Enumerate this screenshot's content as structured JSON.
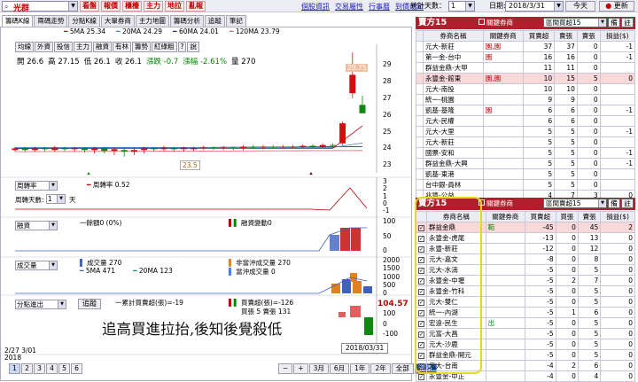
{
  "topbar": {
    "stock": "光群",
    "menu": [
      "看盤",
      "報價",
      "櫃檯",
      "主力",
      "地拉",
      "亂報"
    ],
    "links": [
      "個股資訊",
      "交易屬性",
      "行事曆",
      "到價通知"
    ],
    "stat_label": "統計天數：",
    "stat_days": "1",
    "date_label": "日期:",
    "date": "2018/3/31",
    "today_btn": "今天",
    "refresh_btn": "更新"
  },
  "left_tabs": [
    "籌碼K線",
    "兩碼走勢",
    "分點K線",
    "大單券商",
    "主力地圖",
    "籌碼分析",
    "追蹤",
    "筆記"
  ],
  "ma": [
    {
      "label": "5MA 25.34",
      "color": "#c00000"
    },
    {
      "label": "20MA 24.29",
      "color": "#4080c0"
    },
    {
      "label": "60MA 24.01",
      "color": "#203080"
    },
    {
      "label": "120MA 23.79",
      "color": "#e06060"
    }
  ],
  "chart_buttons": [
    "均線",
    "外資",
    "投信",
    "主力",
    "融資",
    "有林",
    "籌勢",
    "紅綠粗",
    "?",
    "說"
  ],
  "ohlc": {
    "open": "開 26.6",
    "high": "高 27.15",
    "low": "低 26.1",
    "close": "收 26.1",
    "change": "漲跌 -0.7",
    "pct": "漲幅 -2.61%",
    "vol": "量 270"
  },
  "price_axis": [
    "29",
    "28",
    "27",
    "26",
    "25",
    "24",
    "23"
  ],
  "high_marker": "29.75",
  "low_marker": "23.5",
  "candles": [
    {
      "o": 23.9,
      "c": 24.0,
      "h": 24.1,
      "l": 23.8
    },
    {
      "o": 24.0,
      "c": 23.9,
      "h": 24.1,
      "l": 23.8
    },
    {
      "o": 23.9,
      "c": 24.0,
      "h": 24.1,
      "l": 23.8
    },
    {
      "o": 24.0,
      "c": 23.95,
      "h": 24.1,
      "l": 23.8
    },
    {
      "o": 23.9,
      "c": 24.05,
      "h": 24.15,
      "l": 23.8
    },
    {
      "o": 24.0,
      "c": 23.95,
      "h": 24.1,
      "l": 23.85
    },
    {
      "o": 23.95,
      "c": 24.0,
      "h": 24.1,
      "l": 23.8
    },
    {
      "o": 24.0,
      "c": 23.9,
      "h": 24.05,
      "l": 23.75
    },
    {
      "o": 23.9,
      "c": 24.0,
      "h": 24.1,
      "l": 23.7
    },
    {
      "o": 24.0,
      "c": 23.85,
      "h": 24.1,
      "l": 23.7
    },
    {
      "o": 23.85,
      "c": 23.95,
      "h": 24.05,
      "l": 23.6
    },
    {
      "o": 23.9,
      "c": 23.8,
      "h": 24.0,
      "l": 23.5
    },
    {
      "o": 23.8,
      "c": 23.9,
      "h": 24.0,
      "l": 23.6
    },
    {
      "o": 23.9,
      "c": 24.0,
      "h": 24.1,
      "l": 23.7
    },
    {
      "o": 24.0,
      "c": 23.95,
      "h": 24.1,
      "l": 23.8
    },
    {
      "o": 23.95,
      "c": 24.05,
      "h": 24.15,
      "l": 23.85
    },
    {
      "o": 24.0,
      "c": 23.95,
      "h": 24.1,
      "l": 23.8
    },
    {
      "o": 23.95,
      "c": 24.05,
      "h": 24.1,
      "l": 23.8
    },
    {
      "o": 24.0,
      "c": 24.0,
      "h": 24.1,
      "l": 23.85
    },
    {
      "o": 24.0,
      "c": 24.05,
      "h": 24.15,
      "l": 23.9
    },
    {
      "o": 24.05,
      "c": 24.0,
      "h": 24.1,
      "l": 23.9
    },
    {
      "o": 24.0,
      "c": 24.05,
      "h": 24.15,
      "l": 23.9
    },
    {
      "o": 24.05,
      "c": 24.0,
      "h": 24.1,
      "l": 23.9
    },
    {
      "o": 24.0,
      "c": 24.1,
      "h": 24.2,
      "l": 23.9
    },
    {
      "o": 24.1,
      "c": 24.05,
      "h": 24.2,
      "l": 23.95
    },
    {
      "o": 24.05,
      "c": 24.1,
      "h": 24.2,
      "l": 23.95
    },
    {
      "o": 24.1,
      "c": 24.05,
      "h": 24.2,
      "l": 24.0
    },
    {
      "o": 24.05,
      "c": 24.1,
      "h": 24.2,
      "l": 24.0
    },
    {
      "o": 24.1,
      "c": 24.1,
      "h": 24.2,
      "l": 24.0
    },
    {
      "o": 24.1,
      "c": 24.15,
      "h": 24.25,
      "l": 24.0
    },
    {
      "o": 24.15,
      "c": 24.1,
      "h": 24.25,
      "l": 24.0
    },
    {
      "o": 24.1,
      "c": 24.2,
      "h": 24.3,
      "l": 24.0
    },
    {
      "o": 24.2,
      "c": 24.15,
      "h": 24.3,
      "l": 24.05
    },
    {
      "o": 24.3,
      "c": 25.5,
      "h": 25.6,
      "l": 24.2
    },
    {
      "o": 27.3,
      "c": 28.4,
      "h": 29.75,
      "l": 27.0
    },
    {
      "o": 26.6,
      "c": 26.1,
      "h": 27.15,
      "l": 26.1
    }
  ],
  "panels": {
    "turnover": {
      "label": "周轉率",
      "text": "周轉率 0.52",
      "days_label": "周轉天數:",
      "days": "1",
      "unit": "天",
      "axis": [
        "3",
        "2",
        "1",
        "0",
        "-1"
      ]
    },
    "margin": {
      "label": "融資",
      "text1": "一餘額0 (0%)",
      "text2": "融資變動0",
      "axis": [
        "100",
        "50",
        "0"
      ]
    },
    "volume": {
      "label": "成交量",
      "text1": "成交量 270",
      "text2": "非當沖成交量 270",
      "text3": "5MA 471",
      "text4": "20MA 123",
      "text5": "當沖成交量 0",
      "axis": [
        "2000",
        "1500",
        "1000",
        "500",
        "0"
      ]
    },
    "broker": {
      "label": "分點進出",
      "btn": "追蹤",
      "text1": "一累計買賣超(張)=-19",
      "text2": "買賣超(張)=-126",
      "text3": "買張 5 賣張 131",
      "axis": [
        "100",
        "0",
        "-100"
      ],
      "value": "104.57"
    }
  },
  "date_tip": "2018/03/31",
  "x_date": "2/27 3/01",
  "x_year": "2018",
  "annotation": "追高買進拉抬,後知後覺殺低",
  "page_btns": [
    "1",
    "2",
    "3",
    "4",
    "5",
    "6"
  ],
  "period_btns": [
    "3月",
    "6月",
    "1年",
    "2年",
    "全部",
    "還原"
  ],
  "sell_panel": {
    "title": "賣方15",
    "opt": "關鍵券商",
    "select": "區間買超15",
    "btns": [
      "備",
      "註"
    ],
    "headers": [
      "券商名稱",
      "關鍵券商",
      "買賣超",
      "賣張",
      "賣張",
      "損益($)"
    ],
    "rows": [
      [
        "元大-新莊",
        "園,園",
        "37",
        "37",
        "0",
        "-1"
      ],
      [
        "第一金-台中",
        "園",
        "16",
        "16",
        "0",
        "-1"
      ],
      [
        "群益金鼎-大甲",
        "",
        "11",
        "11",
        "0",
        ""
      ],
      [
        "永豐金-館東",
        "園,園",
        "10",
        "15",
        "5",
        "0"
      ],
      [
        "元大-南投",
        "",
        "10",
        "10",
        "0",
        ""
      ],
      [
        "統一-桃園",
        "",
        "9",
        "9",
        "0",
        ""
      ],
      [
        "凱基-基隆",
        "園",
        "6",
        "6",
        "0",
        "-1"
      ],
      [
        "元大-民權",
        "",
        "6",
        "6",
        "0",
        ""
      ],
      [
        "元大-大里",
        "",
        "5",
        "5",
        "0",
        "-1"
      ],
      [
        "元大-新莊",
        "",
        "5",
        "5",
        "0",
        ""
      ],
      [
        "國票-安和",
        "",
        "5",
        "5",
        "0",
        "-1"
      ],
      [
        "群益金鼎-大興",
        "",
        "5",
        "5",
        "0",
        "-1"
      ],
      [
        "凱基-東港",
        "",
        "5",
        "5",
        "0",
        ""
      ],
      [
        "台中銀-員林",
        "",
        "5",
        "5",
        "0",
        ""
      ],
      [
        "兆豐-公益",
        "",
        "4",
        "7",
        "3",
        "0"
      ]
    ]
  },
  "buy_panel": {
    "title": "賣方15",
    "opt": "關鍵券商",
    "select": "區間賣超15",
    "btns": [
      "備",
      "註"
    ],
    "headers": [
      "",
      "券商名稱",
      "關鍵券商",
      "買賣超",
      "買張",
      "賣張",
      "損益($)"
    ],
    "rows": [
      [
        "群益金鼎",
        "範",
        "-45",
        "0",
        "45",
        "2"
      ],
      [
        "永豐金-虎尾",
        "",
        "-13",
        "0",
        "13",
        "0"
      ],
      [
        "永豐-新莊",
        "",
        "-12",
        "0",
        "12",
        "0"
      ],
      [
        "元大-嘉文",
        "",
        "-8",
        "0",
        "8",
        "0"
      ],
      [
        "元大-水湳",
        "",
        "-5",
        "0",
        "5",
        "0"
      ],
      [
        "永豐金-中壢",
        "",
        "-5",
        "2",
        "7",
        "0"
      ],
      [
        "永豐金-竹科",
        "",
        "-5",
        "0",
        "5",
        "0"
      ],
      [
        "元大-雙仁",
        "",
        "-5",
        "0",
        "5",
        "0"
      ],
      [
        "統一-內湖",
        "",
        "-5",
        "1",
        "6",
        "0"
      ],
      [
        "宏遠-民生",
        "出",
        "-5",
        "0",
        "5",
        "0"
      ],
      [
        "元富-大昌",
        "",
        "-5",
        "0",
        "5",
        "0"
      ],
      [
        "元大-沙鹿",
        "",
        "-5",
        "0",
        "5",
        "0"
      ],
      [
        "群益金鼎-開元",
        "",
        "-5",
        "0",
        "5",
        "0"
      ],
      [
        "元大-台南",
        "",
        "-4",
        "2",
        "6",
        "0"
      ],
      [
        "永豐金-中正",
        "",
        "-4",
        "0",
        "4",
        "0"
      ]
    ]
  }
}
